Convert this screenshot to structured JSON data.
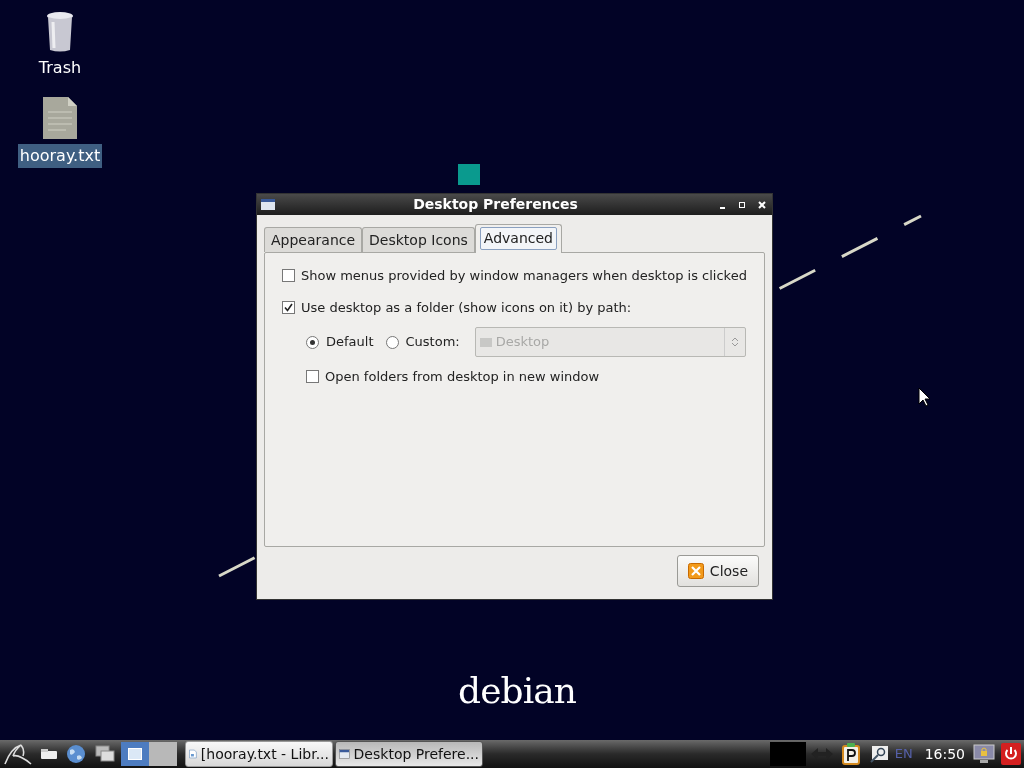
{
  "desktop_icons": [
    {
      "kind": "trash",
      "label": "Trash",
      "selected": false
    },
    {
      "kind": "file",
      "label": "hooray.txt",
      "selected": true
    }
  ],
  "wallpaper": {
    "logo": "debian"
  },
  "dialog": {
    "title": "Desktop Preferences",
    "tabs": [
      {
        "label": "Appearance",
        "selected": false
      },
      {
        "label": "Desktop Icons",
        "selected": false
      },
      {
        "label": "Advanced",
        "selected": true
      }
    ],
    "show_menus": {
      "label": "Show menus provided by window managers when desktop is clicked",
      "checked": false
    },
    "use_desktop_folder": {
      "label": "Use desktop as a folder (show icons on it) by path:",
      "checked": true
    },
    "path_choice": [
      {
        "label": "Default",
        "selected": true
      },
      {
        "label": "Custom:",
        "selected": false
      }
    ],
    "custom_path": {
      "value": "Desktop",
      "disabled": true
    },
    "open_in_new_window": {
      "label": "Open folders from desktop in new window",
      "checked": false
    },
    "close_button": "Close"
  },
  "taskbar": {
    "tasks": [
      {
        "kind": "document",
        "label": "[hooray.txt - Libr...",
        "selected": false
      },
      {
        "kind": "window",
        "label": "Desktop Prefere...",
        "selected": true
      }
    ],
    "language": "EN",
    "clock": "16:50"
  }
}
